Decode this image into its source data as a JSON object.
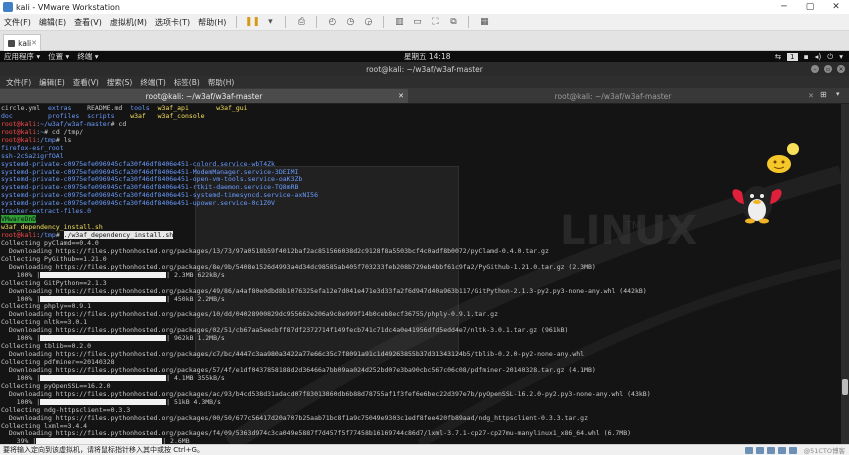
{
  "vmware": {
    "title": "kali - VMware Workstation",
    "menu": [
      "文件(F)",
      "编辑(E)",
      "查看(V)",
      "虚拟机(M)",
      "选项卡(T)",
      "帮助(H)"
    ],
    "tab_label": "kali",
    "status_text": "要将输入定向到该虚拟机，请将鼠标指针移入其中或按 Ctrl+G。",
    "watermark": "@51CTO博客"
  },
  "kali_panel": {
    "applications": "应用程序 ▾",
    "places": "位置 ▾",
    "terminal_menu": "终端 ▾",
    "clock": "星期五 14:18",
    "workspace": "1"
  },
  "terminal": {
    "window_title": "root@kali: ~/w3af/w3af-master",
    "menu": [
      "文件(F)",
      "编辑(E)",
      "查看(V)",
      "搜索(S)",
      "终端(T)",
      "标签(B)",
      "帮助(H)"
    ],
    "tabs": [
      {
        "label": "root@kali: ~/w3af/w3af-master",
        "active": true
      },
      {
        "label": "root@kali: ~/w3af/w3af-master",
        "active": false
      }
    ],
    "lines": [
      [
        {
          "t": "circle.yml  "
        },
        {
          "t": "extras",
          "c": "c-blue"
        },
        {
          "t": "    README.md  "
        },
        {
          "t": "tools",
          "c": "c-blue"
        },
        {
          "t": "  "
        },
        {
          "t": "w3af_api",
          "c": "c-yellow"
        },
        {
          "t": "       "
        },
        {
          "t": "w3af_gui",
          "c": "c-yellow"
        }
      ],
      [
        {
          "t": "doc",
          "c": "c-blue"
        },
        {
          "t": "         "
        },
        {
          "t": "profiles",
          "c": "c-blue"
        },
        {
          "t": "  "
        },
        {
          "t": "scripts",
          "c": "c-blue"
        },
        {
          "t": "    "
        },
        {
          "t": "w3af",
          "c": "c-yellow"
        },
        {
          "t": "   "
        },
        {
          "t": "w3af_console",
          "c": "c-yellow"
        }
      ],
      [
        {
          "t": "root@kali",
          "c": "c-red"
        },
        {
          "t": ":"
        },
        {
          "t": "~/w3af/w3af-master",
          "c": "c-blue"
        },
        {
          "t": "# cd"
        }
      ],
      [
        {
          "t": "root@kali",
          "c": "c-red"
        },
        {
          "t": ":"
        },
        {
          "t": "~",
          "c": "c-blue"
        },
        {
          "t": "# cd /tmp/"
        }
      ],
      [
        {
          "t": "root@kali",
          "c": "c-red"
        },
        {
          "t": ":"
        },
        {
          "t": "/tmp",
          "c": "c-blue"
        },
        {
          "t": "# ls"
        }
      ],
      [
        {
          "t": "firefox-esr_root",
          "c": "c-blue"
        }
      ],
      [
        {
          "t": "ssh-2cSa2igrfOAl",
          "c": "c-blue"
        }
      ],
      [
        {
          "t": "systemd-private-c0975efe096945cfa30f46df8406e451-colord.service-wbT4Zk",
          "c": "c-blue"
        }
      ],
      [
        {
          "t": "systemd-private-c0975efe096945cfa30f46df8406e451-ModemManager.service-3DEIMI",
          "c": "c-blue"
        }
      ],
      [
        {
          "t": "systemd-private-c0975efe096945cfa30f46df8406e451-open-vm-tools.service-oaK3Zb",
          "c": "c-blue"
        }
      ],
      [
        {
          "t": "systemd-private-c0975efe096945cfa30f46df8406e451-rtkit-daemon.service-TQ8mRB",
          "c": "c-blue"
        }
      ],
      [
        {
          "t": "systemd-private-c0975efe096945cfa30f46df8406e451-systemd-timesyncd.service-axNI56",
          "c": "c-blue"
        }
      ],
      [
        {
          "t": "systemd-private-c0975efe096945cfa30f46df8406e451-upower.service-0c1Z0V",
          "c": "c-blue"
        }
      ],
      [
        {
          "t": "tracker-extract-files.0",
          "c": "c-blue"
        }
      ],
      [
        {
          "t": "VMwareDnD",
          "c": "hl-green"
        }
      ],
      [
        {
          "t": "w3af_dependency_install.sh",
          "c": "c-yellow"
        }
      ],
      [
        {
          "t": "root@kali",
          "c": "c-red"
        },
        {
          "t": ":"
        },
        {
          "t": "/tmp",
          "c": "c-blue"
        },
        {
          "t": "# "
        },
        {
          "t": "./w3af_dependency_install.sh",
          "c": "hl"
        }
      ],
      [
        {
          "t": "Collecting pyClamd==0.4.0"
        }
      ],
      [
        {
          "t": "  Downloading https://files.pythonhosted.org/packages/13/73/97a0518b59f4012baf2ac851566038d2c9128f8a5503bcf4c0adf8b0072/pyClamd-0.4.0.tar.gz"
        }
      ],
      [
        {
          "t": "Collecting PyGithub==1.21.0"
        }
      ],
      [
        {
          "t": "  Downloading https://files.pythonhosted.org/packages/8e/9b/5408e1526d4993a4d34dc98585ab405f703233feb208b729eb4bbf61c9fa2/PyGithub-1.21.0.tar.gz (2.3MB)"
        }
      ],
      [
        {
          "t": "    100% |"
        },
        {
          "bar": true
        },
        {
          "t": "| 2.3MB 622kB/s"
        }
      ],
      [
        {
          "t": "Collecting GitPython==2.1.3"
        }
      ],
      [
        {
          "t": "  Downloading https://files.pythonhosted.org/packages/49/86/a4af80e0dbd8b1076325efa12e7d041e471e3d33fa2f6d947d40a963b117/GitPython-2.1.3-py2.py3-none-any.whl (442kB)"
        }
      ],
      [
        {
          "t": "    100% |"
        },
        {
          "bar": true
        },
        {
          "t": "| 450kB 2.2MB/s"
        }
      ],
      [
        {
          "t": "Collecting phply==0.9.1"
        }
      ],
      [
        {
          "t": "  Downloading https://files.pythonhosted.org/packages/10/dd/04028900829dc955662e206a9c8e999f14b0ceb8ecf36755/phply-0.9.1.tar.gz"
        }
      ],
      [
        {
          "t": "Collecting nltk==3.0.1"
        }
      ],
      [
        {
          "t": "  Downloading https://files.pythonhosted.org/packages/02/51/cb67aa5eecbff87df2372714f149fecb741c71dc4a0e41956dfd5edd4e7/nltk-3.0.1.tar.gz (961kB)"
        }
      ],
      [
        {
          "t": "    100% |"
        },
        {
          "bar": true
        },
        {
          "t": "| 962kB 1.2MB/s"
        }
      ],
      [
        {
          "t": "Collecting tblib==0.2.0"
        }
      ],
      [
        {
          "t": "  Downloading https://files.pythonhosted.org/packages/c7/bc/4447c3aa980a3422a77e66c35c7f8091a91c1d49263855b37d31343124b5/tblib-0.2.0-py2-none-any.whl"
        }
      ],
      [
        {
          "t": "Collecting pdfminer==20140328"
        }
      ],
      [
        {
          "t": "  Downloading https://files.pythonhosted.org/packages/57/4f/e1df0437858188d2d36466a7bb09aa024d252bd07e3ba90cbc567c06c08/pdfminer-20140328.tar.gz (4.1MB)"
        }
      ],
      [
        {
          "t": "    100% |"
        },
        {
          "bar": true
        },
        {
          "t": "| 4.1MB 355kB/s"
        }
      ],
      [
        {
          "t": "Collecting pyOpenSSL==16.2.0"
        }
      ],
      [
        {
          "t": "  Downloading https://files.pythonhosted.org/packages/ac/93/b4cd538d31adacd07f83013860db6b88d78755af1f3fef6e6bec22d397e7b/pyOpenSSL-16.2.0-py2.py3-none-any.whl (43kB)"
        }
      ],
      [
        {
          "t": "    100% |"
        },
        {
          "bar": true
        },
        {
          "t": "| 51kB 4.3MB/s"
        }
      ],
      [
        {
          "t": "Collecting ndg-httpsclient==0.3.3"
        }
      ],
      [
        {
          "t": "  Downloading https://files.pythonhosted.org/packages/00/50/677c56417d20a707b25aab71bc8f1a9c75049e9303c1edf8fee420fb89aad/ndg_httpsclient-0.3.3.tar.gz"
        }
      ],
      [
        {
          "t": "Collecting lxml==3.4.4"
        }
      ],
      [
        {
          "t": "  Downloading https://files.pythonhosted.org/packages/f4/09/5363d974c3ca049e5887f7d457f5f77458b16169744c86d7/lxml-3.7.1-cp27-cp27mu-manylinux1_x86_64.whl (6.7MB)"
        }
      ],
      [
        {
          "t": "    39% |"
        },
        {
          "bar": true
        },
        {
          "t": "| 2.6MB"
        }
      ]
    ]
  },
  "colors": {
    "prompt_user": "#ff4a4a",
    "directory": "#6a9bff",
    "executable": "#f5e05a",
    "terminal_bg": "#141414"
  }
}
